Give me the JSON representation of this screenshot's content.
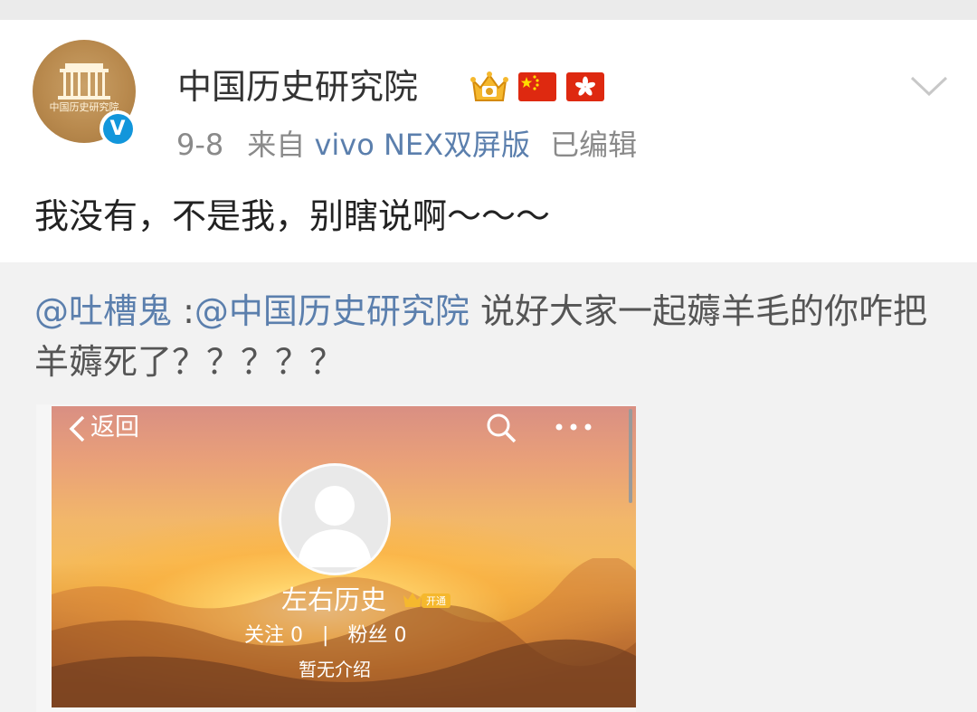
{
  "post": {
    "username": "中国历史研究院",
    "avatar_text": "中国历史研究院",
    "date": "9-8",
    "source_prefix": "来自",
    "device": "vivo NEX双屏版",
    "edited": "已编辑",
    "text": "我没有，不是我，别瞎说啊～～～",
    "icons": [
      "verified-badge-icon",
      "vip-crown-icon",
      "china-flag-icon",
      "hong-kong-flag-icon",
      "chevron-down-icon"
    ]
  },
  "repost": {
    "mention1": "@吐槽鬼",
    "separator": " :",
    "mention2": "@中国历史研究院",
    "text": " 说好大家一起薅羊毛的你咋把羊薅死了？？？？？"
  },
  "screenshot": {
    "back_label": "返回",
    "profile_name": "左右历史",
    "vip_label": "开通",
    "following_label": "关注",
    "following_count": "0",
    "divider": "|",
    "followers_label": "粉丝",
    "followers_count": "0",
    "bio": "暂无介绍"
  },
  "colors": {
    "link": "#5b7fad",
    "verified": "#1296db",
    "text": "#222222",
    "meta": "#8a8a8a"
  }
}
